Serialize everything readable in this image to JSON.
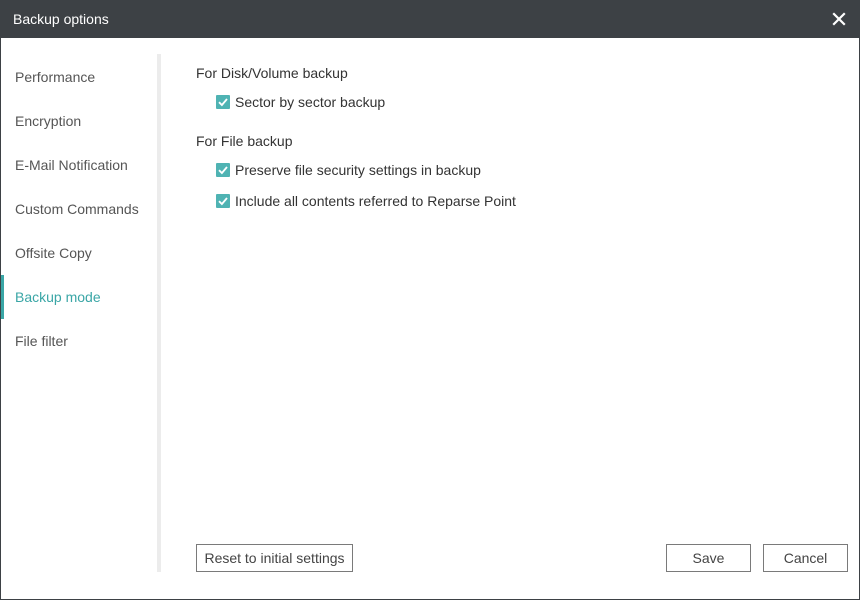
{
  "window": {
    "title": "Backup options"
  },
  "sidebar": {
    "items": [
      {
        "label": "Performance",
        "active": false
      },
      {
        "label": "Encryption",
        "active": false
      },
      {
        "label": "E-Mail Notification",
        "active": false
      },
      {
        "label": "Custom Commands",
        "active": false
      },
      {
        "label": "Offsite Copy",
        "active": false
      },
      {
        "label": "Backup mode",
        "active": true
      },
      {
        "label": "File filter",
        "active": false
      }
    ]
  },
  "main": {
    "disk_section": {
      "title": "For Disk/Volume backup",
      "options": [
        {
          "label": "Sector by sector backup",
          "checked": true
        }
      ]
    },
    "file_section": {
      "title": "For File backup",
      "options": [
        {
          "label": "Preserve file security settings in backup",
          "checked": true
        },
        {
          "label": "Include all contents referred to Reparse Point",
          "checked": true
        }
      ]
    }
  },
  "footer": {
    "reset_label": "Reset to initial settings",
    "save_label": "Save",
    "cancel_label": "Cancel"
  },
  "colors": {
    "titlebar": "#3d4145",
    "accent": "#3aa6a6",
    "checkbox": "#4fb3b3"
  },
  "icons": {
    "close": "close-icon",
    "check": "checkmark-icon"
  }
}
